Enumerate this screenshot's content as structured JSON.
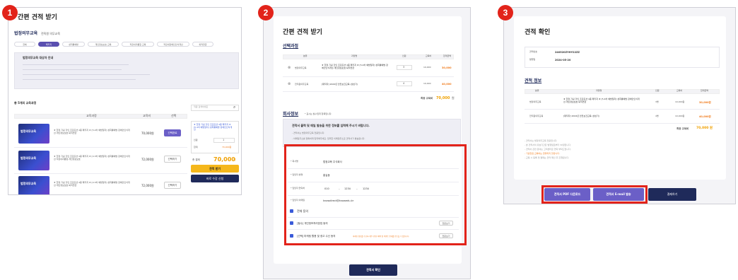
{
  "steps": [
    "1",
    "2",
    "3"
  ],
  "panel1": {
    "title": "간편 견적 받기",
    "category": "법정의무교육",
    "category_sub": "전직원 의무교육",
    "tabs": [
      "전체",
      "패키지",
      "성희롱예방",
      "개인정보보호 교육",
      "직장내괴롭힘 교육",
      "직장내장애인인식개선",
      "퇴직연금"
    ],
    "notice_title": "법정의무교육 대상자 안내",
    "course_count": "총 5개의 교육과정",
    "table_headers": [
      "교육과정",
      "교육비",
      "선택"
    ],
    "courses": [
      {
        "title": "★ 한정 기념 할인 프로모션 4종 패키지 ★ [5.4차 예방일자] 성희롱예방·장애인인식개선·개인정보보호·퇴직연금",
        "price": "70,000원",
        "button": "선택완료"
      },
      {
        "title": "★ 한정 기념 할인 프로모션 4종 패키지 ★ [4.3차 예방일자] 성희롱예방·장애인인식개선·직장내괴롭힘·개인정보보호",
        "price": "72,000원",
        "button": "선택하기"
      },
      {
        "title": "★ 한정 기념 할인 프로모션 4종 패키지 ★ [4.3차 예방일자] 성희롱예방·장애인인식개선·개인정보보호·퇴직연금",
        "price": "72,000원",
        "button": "선택하기"
      }
    ],
    "side_search": "직원 검색하세요",
    "side_item": "★ 한정 기념 할인 프로모션 4종 패키지 ★ [5.4차 예방일자] 성희롱예방·장애인인식개선",
    "side_qty_label": "인원",
    "side_qty": "1",
    "side_sum_label": "합계",
    "side_sum": "70,000원",
    "total_label": "총 결제",
    "total_value": "70,000",
    "total_unit": "원",
    "btn_quote": "견적 받기",
    "btn_apply": "바로 수강 신청"
  },
  "panel2": {
    "title": "간편 견적 받기",
    "section_course": "선택과정",
    "table_headers": [
      "분류",
      "과정명",
      "인원",
      "교육비",
      "합계금액"
    ],
    "rows": [
      {
        "category": "법정의무교육",
        "name": "★ 한정 기념 할인 프로모션 4종 패키지 ★ [5.4차 예방일자] 성희롱예방·장애인인식개선·개인정보보호·퇴직연금",
        "qty": "3",
        "price": "10,000",
        "total": "30,000"
      },
      {
        "category": "전직원의무교육",
        "name": "[재직자] 2024년 안전보건교육 (상반기)",
        "qty": "4",
        "price": "10,000",
        "total": "40,000"
      }
    ],
    "sum_label": "최종 교육비",
    "sum_value": "70,000",
    "sum_unit": "원",
    "section_company": "회사정보",
    "company_note": "* 표시는 필수입력 항목입니다.",
    "info_title": "견적서 출력 및 메일 발송을 위한 정보를 입력해 주시기 바랍니다.",
    "info_lines": [
      "- 견적서는 법정의무교육 전용입니다.",
      "- 이메일주소를 정확하게 입력해주세요. 입력한 이메일주소로 견적서가 발송됩니다."
    ],
    "form": [
      {
        "label": "* 회사명",
        "value": "법정교육 주식회사"
      },
      {
        "label": "* 담당자 성명",
        "value": "홍길동"
      },
      {
        "label": "* 담당자 연락처",
        "value": "010"
      },
      {
        "label": "* 담당자 이메일",
        "value": "knowdirect@knowedu.kr"
      }
    ],
    "phone_mid": "1234",
    "phone_last": "1234",
    "agree_all": "전체 동의",
    "agree_items": [
      {
        "text": "[필수] 개인정보처리방침 동의",
        "button": "전문보기"
      },
      {
        "text": "[선택] 마케팅 활용 및 광고 수신 동의",
        "note": "마케팅 정보를 수신하시면 다양한 혜택 및 이벤트 안내를 받으실 수 있습니다.",
        "button": "전문보기"
      }
    ],
    "submit": "견적서 확인"
  },
  "panel3": {
    "title": "견적 확인",
    "meta": [
      {
        "label": "견적번호",
        "value": "240520ZYHY22ZZ"
      },
      {
        "label": "발행일",
        "value": "2024-05-20"
      }
    ],
    "section": "견적 정보",
    "table_headers": [
      "분류",
      "과정명",
      "인원",
      "교육비",
      "합계금액"
    ],
    "rows": [
      {
        "category": "법정의무교육",
        "name": "★ 한정 기념 할인 프로모션 4종 패키지 ★ [5.4차 예방일자] 성희롱예방·장애인인식개선·개인정보보호·퇴직연금",
        "qty": "3명",
        "price": "10,000원",
        "total": "30,000원"
      },
      {
        "category": "전직원의무교육",
        "name": "[재직자] 2024년 안전보건교육 (상반기)",
        "qty": "4명",
        "price": "10,000원",
        "total": "40,000원"
      }
    ],
    "sum_label": "최종 교육비",
    "sum_value": "70,000 원",
    "notes": [
      "- 견적서는 법정의무교육 전용입니다.",
      "- 본 견적서의 유효기간은 발행일로부터 30일입니다.",
      "- 견적서 관련 문의는 고객센터로 연락 부탁드립니다.",
      "- 기납입된 교육비는 환불되지 않습니다.",
      "- 교육 시 등록 및 결제는 견적 확인 후 진행됩니다."
    ],
    "btn_pdf": "견적서 PDF 다운로드",
    "btn_mail": "견적서 E-mail 발송",
    "btn_pay": "결제하기"
  }
}
